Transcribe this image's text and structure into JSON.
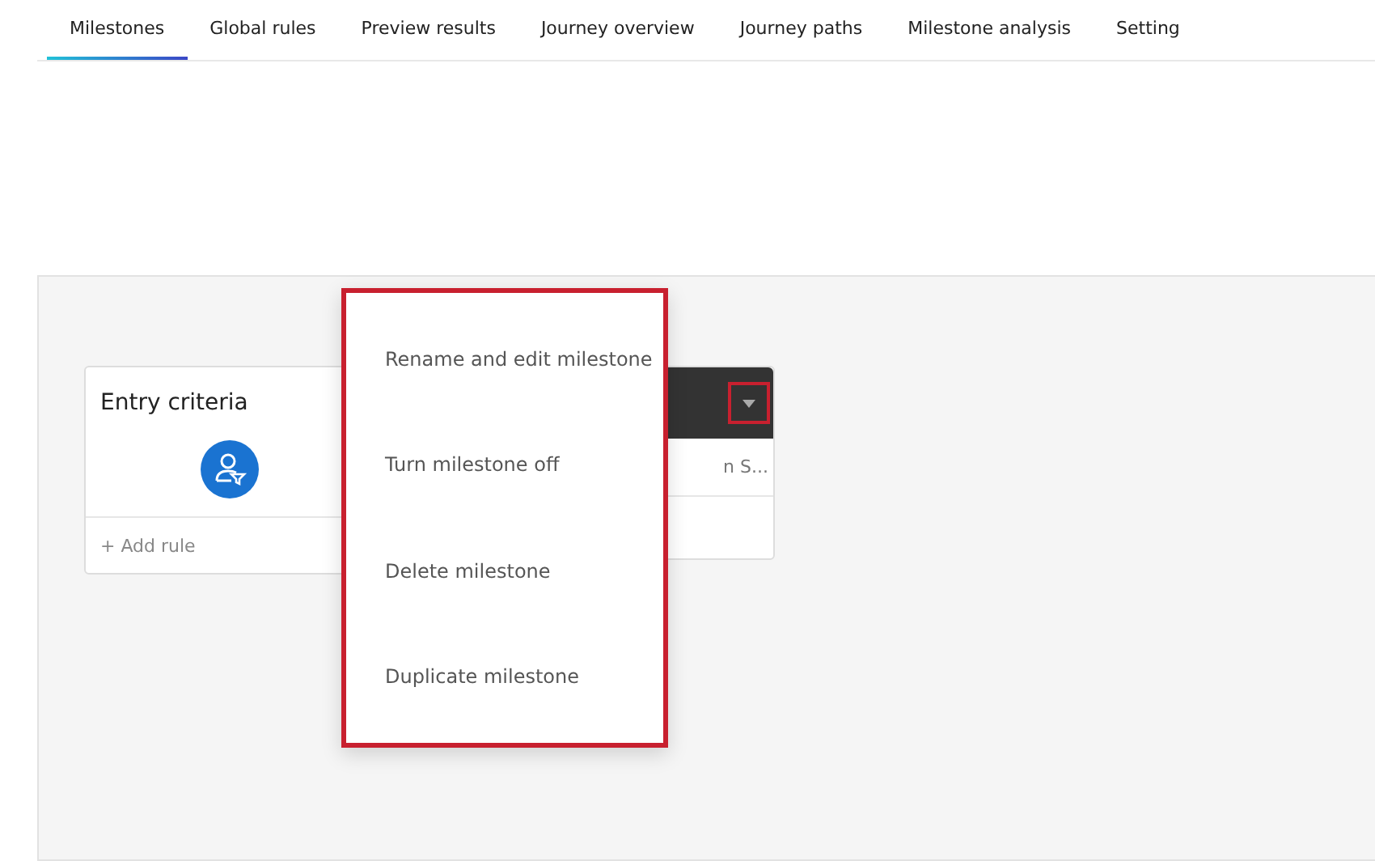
{
  "tabs": [
    {
      "label": "Milestones",
      "selected": true
    },
    {
      "label": "Global rules",
      "selected": false
    },
    {
      "label": "Preview results",
      "selected": false
    },
    {
      "label": "Journey overview",
      "selected": false
    },
    {
      "label": "Journey paths",
      "selected": false
    },
    {
      "label": "Milestone analysis",
      "selected": false
    },
    {
      "label": "Setting",
      "selected": false
    }
  ],
  "entry_card": {
    "title": "Entry criteria",
    "add_rule": "+ Add rule"
  },
  "milestone_card": {
    "subtitle": "n S..."
  },
  "menu": {
    "items": [
      "Rename and edit milestone",
      "Turn milestone off",
      "Delete milestone",
      "Duplicate milestone"
    ]
  }
}
